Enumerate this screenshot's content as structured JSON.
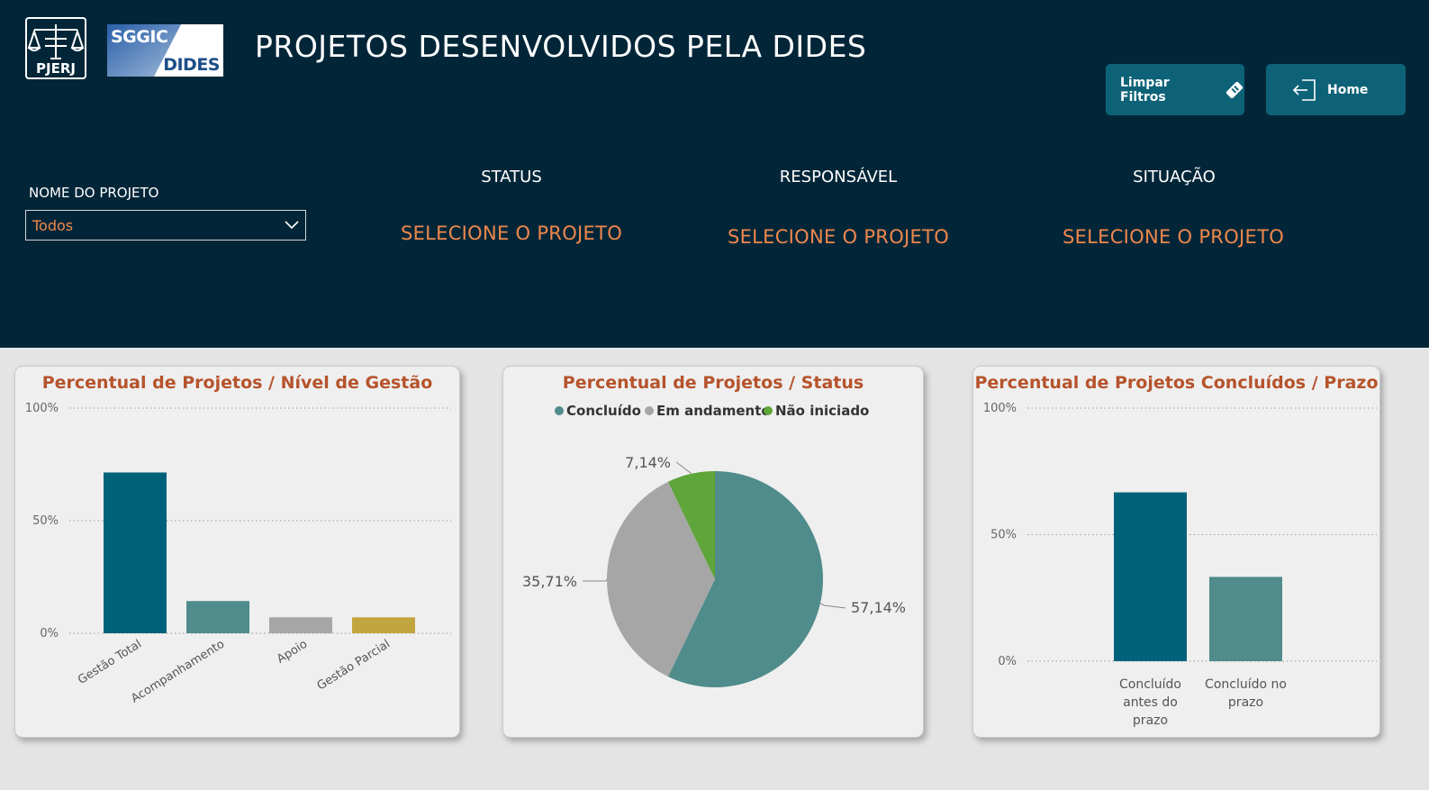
{
  "header": {
    "logo_pjerj_text": "PJERJ",
    "logo_sggic_line1": "SGGIC",
    "logo_sggic_line2": "DIDES",
    "title": "PROJETOS DESENVOLVIDOS PELA DIDES",
    "background": "#022638"
  },
  "buttons": {
    "clear_filters": "Limpar Filtros",
    "clear_filters_icon": "eraser-icon",
    "home": "Home",
    "home_icon": "exit-door-icon"
  },
  "filters": {
    "project_name_label": "NOME DO PROJETO",
    "project_name_value": "Todos"
  },
  "cards": [
    {
      "label": "STATUS",
      "value": "SELECIONE O PROJETO"
    },
    {
      "label": "RESPONSÁVEL",
      "value": "SELECIONE O PROJETO"
    },
    {
      "label": "SITUAÇÃO",
      "value": "SELECIONE O PROJETO"
    }
  ],
  "colors": {
    "accent_orange": "#f0874c",
    "title_orange": "#b6532b",
    "teal_dark": "#00627a",
    "teal_light": "#4f8c8b",
    "gray": "#a6a6a6",
    "gold": "#c3a53f",
    "green": "#5ea53a"
  },
  "chart_data": [
    {
      "type": "bar",
      "title": "Percentual de Projetos / Nível de Gestão",
      "categories": [
        "Gestão Total",
        "Acompanhamento",
        "Apoio",
        "Gestão Parcial"
      ],
      "values": [
        71.4,
        14.3,
        7.1,
        7.1
      ],
      "bar_colors": [
        "#00627a",
        "#4f8c8b",
        "#a6a6a6",
        "#c3a53f"
      ],
      "yticks": [
        "100%",
        "50%",
        "0%"
      ],
      "ylim": [
        0,
        100
      ],
      "grid": true
    },
    {
      "type": "pie",
      "title": "Percentual de Projetos / Status",
      "legend": [
        "Concluído",
        "Em andamento",
        "Não iniciado"
      ],
      "legend_position": "top",
      "values": [
        57.14,
        35.71,
        7.14
      ],
      "labels": [
        "57,14%",
        "35,71%",
        "7,14%"
      ],
      "slice_colors": [
        "#4f8c8b",
        "#a6a6a6",
        "#5ea53a"
      ]
    },
    {
      "type": "bar",
      "title": "Percentual de Projetos Concluídos / Prazo",
      "categories": [
        "Concluído antes do prazo",
        "Concluído no prazo"
      ],
      "category_lines": [
        [
          "Concluído",
          "antes do",
          "prazo"
        ],
        [
          "Concluído no",
          "prazo"
        ]
      ],
      "values": [
        66.7,
        33.3
      ],
      "bar_colors": [
        "#00627a",
        "#4f8c8b"
      ],
      "yticks": [
        "100%",
        "50%",
        "0%"
      ],
      "ylim": [
        0,
        100
      ],
      "grid": true
    }
  ]
}
